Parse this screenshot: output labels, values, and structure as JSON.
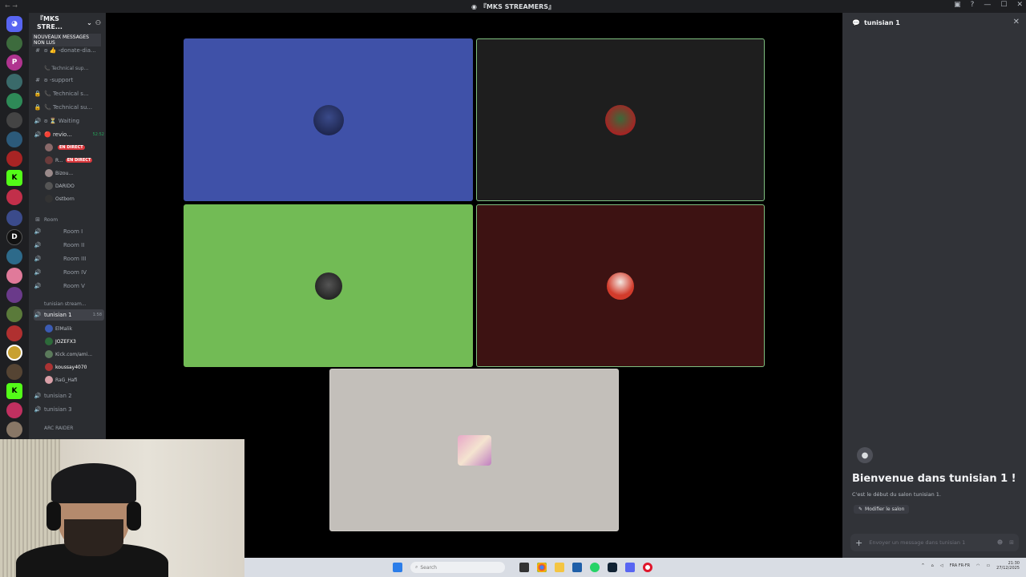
{
  "window": {
    "title": "『MKS STREAMERS』",
    "controls": [
      "—",
      "☐",
      "✕"
    ]
  },
  "server": {
    "name": "『MKS STRE...",
    "unread_banner": "NOUVEAUX MESSAGES NON LUS"
  },
  "channels": [
    {
      "icon": "#",
      "label": "ʚ 👍 -donate-dia...",
      "kind": "text"
    },
    {
      "icon": "",
      "label": "📞 Technical sup...",
      "kind": "category"
    },
    {
      "icon": "#",
      "label": "ʚ -support",
      "kind": "text"
    },
    {
      "icon": "🔒",
      "label": "📞 Technical s...",
      "kind": "voice"
    },
    {
      "icon": "🔒",
      "label": "📞 Technical su...",
      "kind": "voice"
    },
    {
      "icon": "🔊",
      "label": "ʚ ⏳ Waiting",
      "kind": "voice"
    },
    {
      "icon": "🔊",
      "label": "🔴 revio...",
      "kind": "voice",
      "count": "52:52"
    }
  ],
  "voice_users_top": [
    {
      "name": "",
      "live": "EN DIRECT",
      "color": "#8a6a6a"
    },
    {
      "name": "R...",
      "live": "EN DIRECT",
      "color": "#6b3b3b"
    },
    {
      "name": "Bizou...",
      "live": "",
      "color": "#9a8a8a"
    },
    {
      "name": "DARIDO",
      "live": "",
      "color": "#555"
    },
    {
      "name": "Ostborn",
      "live": "",
      "color": "#333"
    }
  ],
  "room_category": "Room",
  "rooms": [
    "Room I",
    "Room II",
    "Room III",
    "Room IV",
    "Room V"
  ],
  "tunisian_category": "tunisian stream...",
  "active_channel": {
    "label": "tunisian 1",
    "count": "1:58"
  },
  "voice_users_bottom": [
    {
      "name": "ElMalik",
      "color": "#3b5bb3"
    },
    {
      "name": "JOZEFX3",
      "color": "#2d6a3a"
    },
    {
      "name": "Kick.com/ami...",
      "color": "#5b7a5b"
    },
    {
      "name": "koussay4070",
      "color": "#a33"
    },
    {
      "name": "RaG_Hafi",
      "color": "#d9a0a8"
    }
  ],
  "other_channels": [
    "tunisian 2",
    "tunisian 3"
  ],
  "arc_category": "ARC RAIDER",
  "stage_tiles": [
    {
      "name": "tile-elmalik",
      "bg": "#3f51a8",
      "border": "#3f51a8",
      "avatar": "#1f2550"
    },
    {
      "name": "tile-jozefx3",
      "bg": "#1e1e1e",
      "border": "#7fbf7f",
      "avatar": "#a62424"
    },
    {
      "name": "tile-kick",
      "bg": "#72bb55",
      "border": "#72bb55",
      "avatar": "#222"
    },
    {
      "name": "tile-koussay",
      "bg": "#3d1212",
      "border": "#7fbf7f",
      "avatar": "#d23b2b"
    },
    {
      "name": "tile-rag",
      "bg": "#c3bfba",
      "border": "#d0ccc7",
      "avatar": "#d9a7c0"
    }
  ],
  "chat": {
    "header": "tunisian 1",
    "welcome_title": "Bienvenue dans tunisian 1 !",
    "welcome_sub": "C'est le début du salon tunisian 1.",
    "edit_label": "Modifier le salon",
    "input_placeholder": "Envoyer un message dans tunisian 1"
  },
  "taskbar": {
    "search_placeholder": "Search",
    "lang": "FRA\nFR-FR",
    "time": "21:30",
    "date": "27/12/2025"
  },
  "colors": {
    "discord_dark": "#1e1f22",
    "sidebar": "#2b2d31",
    "chat_bg": "#313338",
    "accent_green": "#23a559",
    "live_red": "#da373c"
  }
}
